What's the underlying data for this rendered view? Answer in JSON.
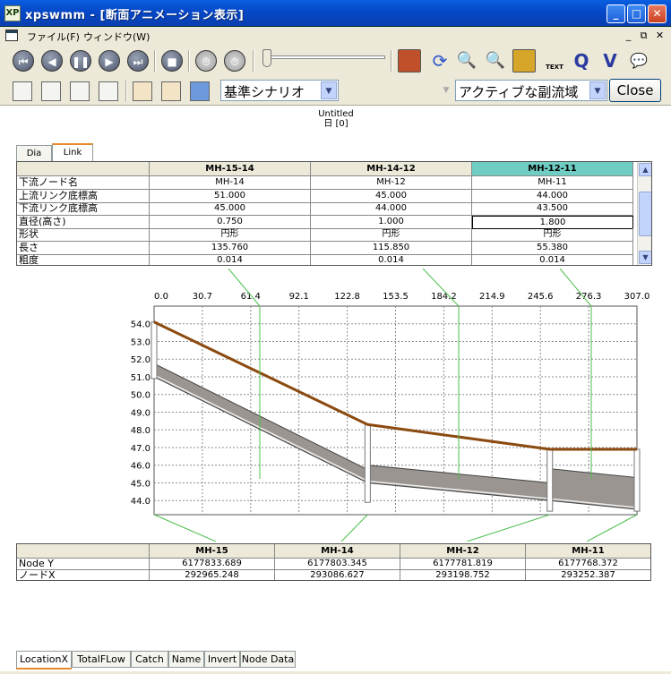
{
  "window": {
    "app_icon": "XP",
    "title": "xpswmm - [断面アニメーション表示]",
    "min": "_",
    "max": "□",
    "close": "✕"
  },
  "menu": {
    "file": "ファイル(F)",
    "window": "ウィンドウ(W)",
    "mdi_min": "_",
    "mdi_restore": "⧉",
    "mdi_close": "✕"
  },
  "toolbar": {
    "scenario": "基準シナリオ",
    "subcatchment": "アクティブな副流域",
    "close_label": "Close",
    "q_label": "Q",
    "v_label": "V",
    "text_label": "TEXT"
  },
  "doc_title": [
    "Untitled",
    "日 [0]"
  ],
  "link_tabs": {
    "dia": "Dia",
    "link": "Link"
  },
  "link_table": {
    "columns": [
      "MH-15-14",
      "MH-14-12",
      "MH-12-11"
    ],
    "rows": [
      {
        "label": "下流ノード名",
        "values": [
          "MH-14",
          "MH-12",
          "MH-11"
        ]
      },
      {
        "label": "上流リンク底標高",
        "values": [
          "51.000",
          "45.000",
          "44.000"
        ]
      },
      {
        "label": "下流リンク底標高",
        "values": [
          "45.000",
          "44.000",
          "43.500"
        ]
      },
      {
        "label": "直径(高さ)",
        "values": [
          "0.750",
          "1.000",
          "1.800"
        ]
      },
      {
        "label": "形状",
        "values": [
          "円形",
          "円形",
          "円形"
        ]
      },
      {
        "label": "長さ",
        "values": [
          "135.760",
          "115.850",
          "55.380"
        ]
      },
      {
        "label": "粗度",
        "values": [
          "0.014",
          "0.014",
          "0.014"
        ]
      }
    ]
  },
  "chart_data": {
    "type": "line",
    "x_ticks": [
      "0.0",
      "30.7",
      "61.4",
      "92.1",
      "122.8",
      "153.5",
      "184.2",
      "214.9",
      "245.6",
      "276.3",
      "307.0"
    ],
    "y_ticks": [
      "54.0",
      "53.0",
      "52.0",
      "51.0",
      "50.0",
      "49.0",
      "48.0",
      "47.0",
      "46.0",
      "45.0",
      "44.0"
    ],
    "xlim": [
      0,
      307.0
    ],
    "ylim": [
      43.2,
      55.0
    ],
    "grid": true,
    "ground": {
      "x": [
        0,
        135.76,
        251.61,
        307.0
      ],
      "y": [
        54.1,
        48.3,
        46.9,
        46.9
      ]
    },
    "manholes_x": [
      0,
      135.76,
      251.61,
      307.0
    ],
    "pipes": [
      {
        "x": [
          0,
          135.76
        ],
        "invert": [
          51.0,
          45.0
        ],
        "height": 0.75
      },
      {
        "x": [
          135.76,
          251.61
        ],
        "invert": [
          45.0,
          44.0
        ],
        "height": 1.0
      },
      {
        "x": [
          251.61,
          307.0
        ],
        "invert": [
          44.0,
          43.5
        ],
        "height": 1.8
      }
    ]
  },
  "node_table": {
    "columns": [
      "MH-15",
      "MH-14",
      "MH-12",
      "MH-11"
    ],
    "rows": [
      {
        "label": "Node Y",
        "values": [
          "6177833.689",
          "6177803.345",
          "6177781.819",
          "6177768.372"
        ]
      },
      {
        "label": "ノードX",
        "values": [
          "292965.248",
          "293086.627",
          "293198.752",
          "293252.387"
        ]
      }
    ]
  },
  "bottom_tabs": [
    "LocationX",
    "TotalFLow",
    "Catch",
    "Name",
    "Invert",
    "Node Data"
  ],
  "colors": {
    "ground": "#8b4a10",
    "pipe_fill": "#9a9590",
    "grid": "#8c8c8c",
    "connector": "#4cbf4c",
    "selected_col": "#6fcdc4"
  }
}
